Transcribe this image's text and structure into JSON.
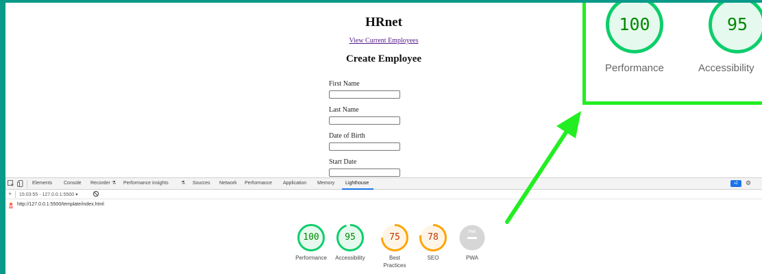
{
  "page": {
    "title": "HRnet",
    "link_text": "View Current Employees",
    "subtitle": "Create Employee",
    "fields": [
      {
        "label": "First Name",
        "value": ""
      },
      {
        "label": "Last Name",
        "value": ""
      },
      {
        "label": "Date of Birth",
        "value": ""
      },
      {
        "label": "Start Date",
        "value": ""
      }
    ]
  },
  "devtools": {
    "tabs": [
      "Elements",
      "Console",
      "Recorder",
      "Performance insights",
      "Sources",
      "Network",
      "Performance",
      "Application",
      "Memory",
      "Lighthouse"
    ],
    "active_tab": "Lighthouse",
    "issues_badge": "2",
    "report_selector": "15:03:55 - 127.0.0.1:5500",
    "url": "http://127.0.0.1:5500/template/index.html"
  },
  "lighthouse": {
    "scores": [
      {
        "label": "Performance",
        "value": "100",
        "fraction": 1.0,
        "color": "#0cce6b",
        "text_color": "#008800",
        "bg": "#e6f9ee"
      },
      {
        "label": "Accessibility",
        "value": "95",
        "fraction": 0.95,
        "color": "#0cce6b",
        "text_color": "#008800",
        "bg": "#e6f9ee"
      },
      {
        "label": "Best Practices",
        "value": "75",
        "fraction": 0.75,
        "color": "#ffa400",
        "text_color": "#c33300",
        "bg": "#fff5e6"
      },
      {
        "label": "SEO",
        "value": "78",
        "fraction": 0.78,
        "color": "#ffa400",
        "text_color": "#c33300",
        "bg": "#fff5e6"
      },
      {
        "label": "PWA",
        "value": "PWA",
        "fraction": 0,
        "color": "#d0d0d0",
        "text_color": "#ffffff",
        "bg": "#d6d6d6"
      }
    ]
  },
  "callout": {
    "border_color": "#22ee22",
    "scores": [
      {
        "label": "Performance",
        "value": "100",
        "fraction": 1.0
      },
      {
        "label": "Accessibility",
        "value": "95",
        "fraction": 0.95
      }
    ]
  }
}
